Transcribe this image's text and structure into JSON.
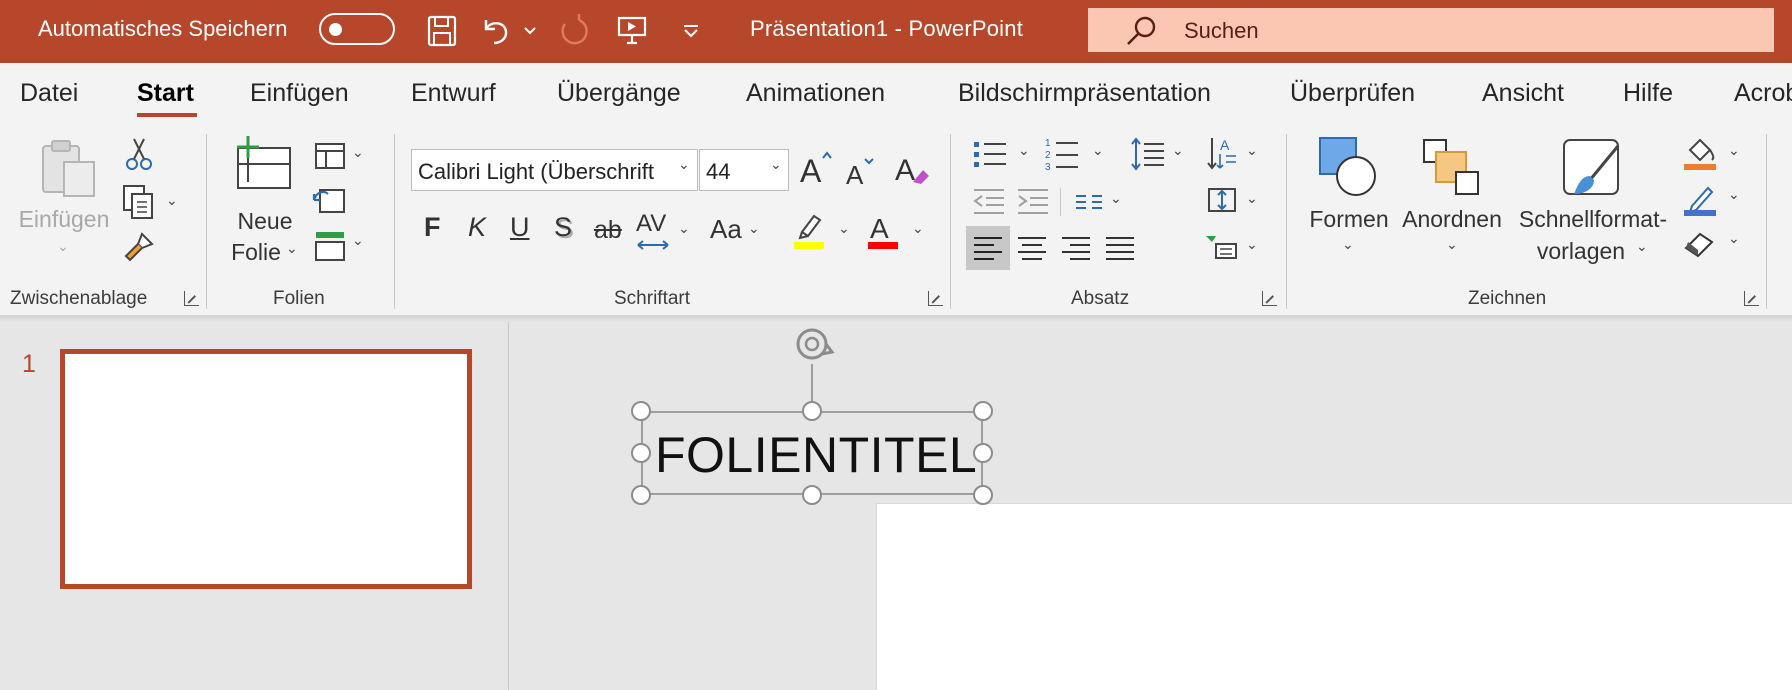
{
  "titlebar": {
    "autosave_label": "Automatisches Speichern",
    "autosave_state": "off",
    "doc_title": "Präsentation1  -  PowerPoint",
    "search_placeholder": "Suchen",
    "color": "#b7472a"
  },
  "tabs": [
    {
      "label": "Datei"
    },
    {
      "label": "Start",
      "active": true
    },
    {
      "label": "Einfügen"
    },
    {
      "label": "Entwurf"
    },
    {
      "label": "Übergänge"
    },
    {
      "label": "Animationen"
    },
    {
      "label": "Bildschirmpräsentation"
    },
    {
      "label": "Überprüfen"
    },
    {
      "label": "Ansicht"
    },
    {
      "label": "Hilfe"
    },
    {
      "label": "Acrob"
    }
  ],
  "ribbon": {
    "clipboard": {
      "group_label": "Zwischenablage",
      "paste_label": "Einfügen"
    },
    "slides": {
      "group_label": "Folien",
      "new_slide_line1": "Neue",
      "new_slide_line2": "Folie"
    },
    "font": {
      "group_label": "Schriftart",
      "font_name": "Calibri Light (Überschrift",
      "font_size": "44",
      "bold": "F",
      "italic": "K",
      "underline": "U",
      "shadow": "S",
      "strike": "ab",
      "spacing": "AV",
      "case": "Aa",
      "highlight_color": "#ffff00",
      "font_color": "#ff0000"
    },
    "paragraph": {
      "group_label": "Absatz"
    },
    "drawing": {
      "group_label": "Zeichnen",
      "shapes_label": "Formen",
      "arrange_label": "Anordnen",
      "quickstyles_line1": "Schnellformat-",
      "quickstyles_line2": "vorlagen"
    }
  },
  "slides_panel": {
    "slide_number": "1"
  },
  "slide": {
    "title_placeholder": "FOLIENTITEL"
  }
}
